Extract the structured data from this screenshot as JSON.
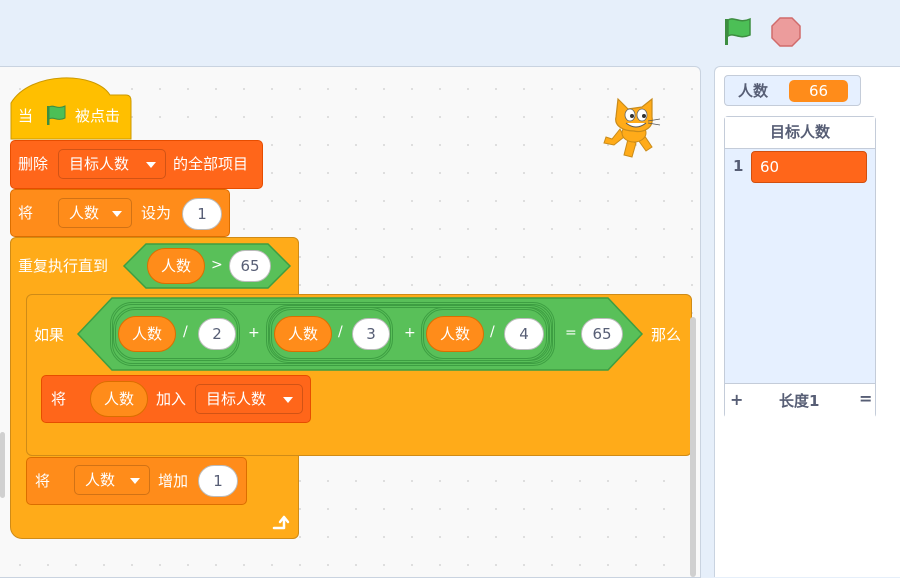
{
  "controls": {
    "green_flag": "green-flag-icon",
    "stop": "stop-icon"
  },
  "script": {
    "hat": {
      "when": "当",
      "clicked": "被点击"
    },
    "delete_all": {
      "prefix": "删除",
      "list": "目标人数",
      "suffix": "的全部项目"
    },
    "set_var": {
      "prefix": "将",
      "var": "人数",
      "mid": "设为",
      "value": "1"
    },
    "repeat_until": {
      "label": "重复执行直到",
      "var": "人数",
      "op": ">",
      "value": "65"
    },
    "if_block": {
      "label": "如果",
      "then": "那么",
      "var1": "人数",
      "div1": "/",
      "n1": "2",
      "plus1": "+",
      "var2": "人数",
      "div2": "/",
      "n2": "3",
      "plus2": "+",
      "var3": "人数",
      "div3": "/",
      "n3": "4",
      "eq": "=",
      "result": "65"
    },
    "add_item": {
      "prefix": "将",
      "var": "人数",
      "mid": "加入",
      "list": "目标人数"
    },
    "change_var": {
      "prefix": "将",
      "var": "人数",
      "mid": "增加",
      "value": "1"
    }
  },
  "stage": {
    "var_monitor": {
      "name": "人数",
      "value": "66"
    },
    "list_monitor": {
      "title": "目标人数",
      "items": [
        {
          "index": "1",
          "value": "60"
        }
      ],
      "add": "+",
      "length": "长度1",
      "resize": "="
    }
  },
  "colors": {
    "events": "#ffbf00",
    "lists": "#ff661a",
    "variables": "#ff8c1a",
    "control": "#ffab19",
    "operators": "#59c059"
  }
}
